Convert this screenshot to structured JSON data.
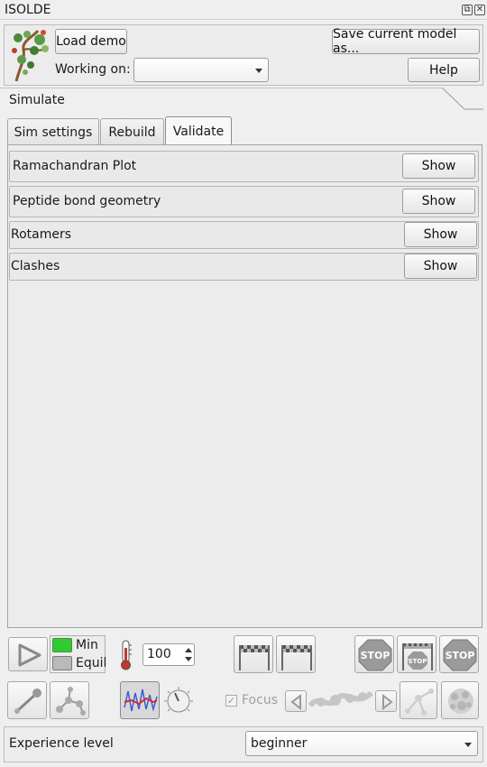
{
  "window": {
    "title": "ISOLDE"
  },
  "header": {
    "load_demo": "Load demo",
    "save_model": "Save current model as...",
    "working_on_label": "Working on:",
    "working_on_value": "",
    "help": "Help"
  },
  "section": {
    "title": "Simulate"
  },
  "tabs": [
    {
      "label": "Sim settings",
      "active": false
    },
    {
      "label": "Rebuild",
      "active": false
    },
    {
      "label": "Validate",
      "active": true
    }
  ],
  "validate_rows": [
    {
      "label": "Ramachandran Plot",
      "button": "Show"
    },
    {
      "label": "Peptide bond geometry",
      "button": "Show"
    },
    {
      "label": "Rotamers",
      "button": "Show"
    },
    {
      "label": "Clashes",
      "button": "Show"
    }
  ],
  "controls": {
    "min_label": "Min",
    "equil_label": "Equil",
    "temperature": "100",
    "focus_label": "Focus",
    "stop_text": "STOP",
    "status_colors": {
      "min": "#2ecc2e",
      "equil": "#b9b9b9"
    }
  },
  "footer": {
    "experience_label": "Experience level",
    "experience_value": "beginner"
  },
  "icons": [
    "isolde-logo-icon",
    "play-icon",
    "thermometer-icon",
    "checkered-flag-icon",
    "stop-icon",
    "atom-select-icon",
    "molecule-icon",
    "simulation-graph-icon",
    "knob-icon",
    "prev-icon",
    "next-icon",
    "spotlight-icon",
    "mask-icon"
  ]
}
